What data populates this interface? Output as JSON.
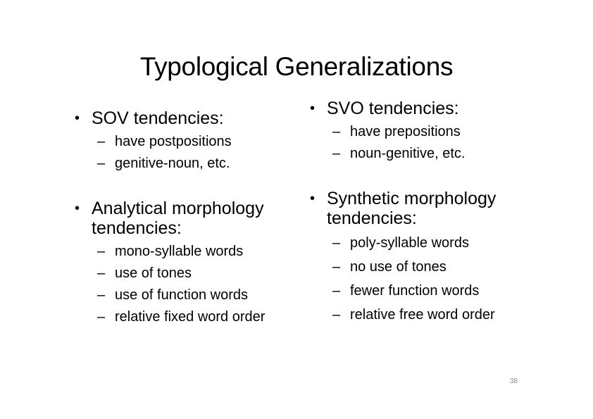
{
  "slide": {
    "title": "Typological Generalizations",
    "page_number": "38"
  },
  "left_column": {
    "groups": [
      {
        "bullet": "SOV tendencies:",
        "subs": [
          "have postpositions",
          "genitive-noun, etc."
        ]
      },
      {
        "bullet": "Analytical morphology tendencies:",
        "subs": [
          "mono-syllable words",
          "use of tones",
          "use of function words",
          "relative fixed word order"
        ]
      }
    ]
  },
  "right_column": {
    "groups": [
      {
        "bullet": "SVO tendencies:",
        "subs": [
          "have prepositions",
          "noun-genitive, etc."
        ]
      },
      {
        "bullet": "Synthetic morphology tendencies:",
        "subs": [
          "poly-syllable words",
          "no use of tones",
          "fewer function words",
          "relative free word order"
        ]
      }
    ]
  },
  "glyphs": {
    "bullet": "•",
    "dash": "–"
  }
}
